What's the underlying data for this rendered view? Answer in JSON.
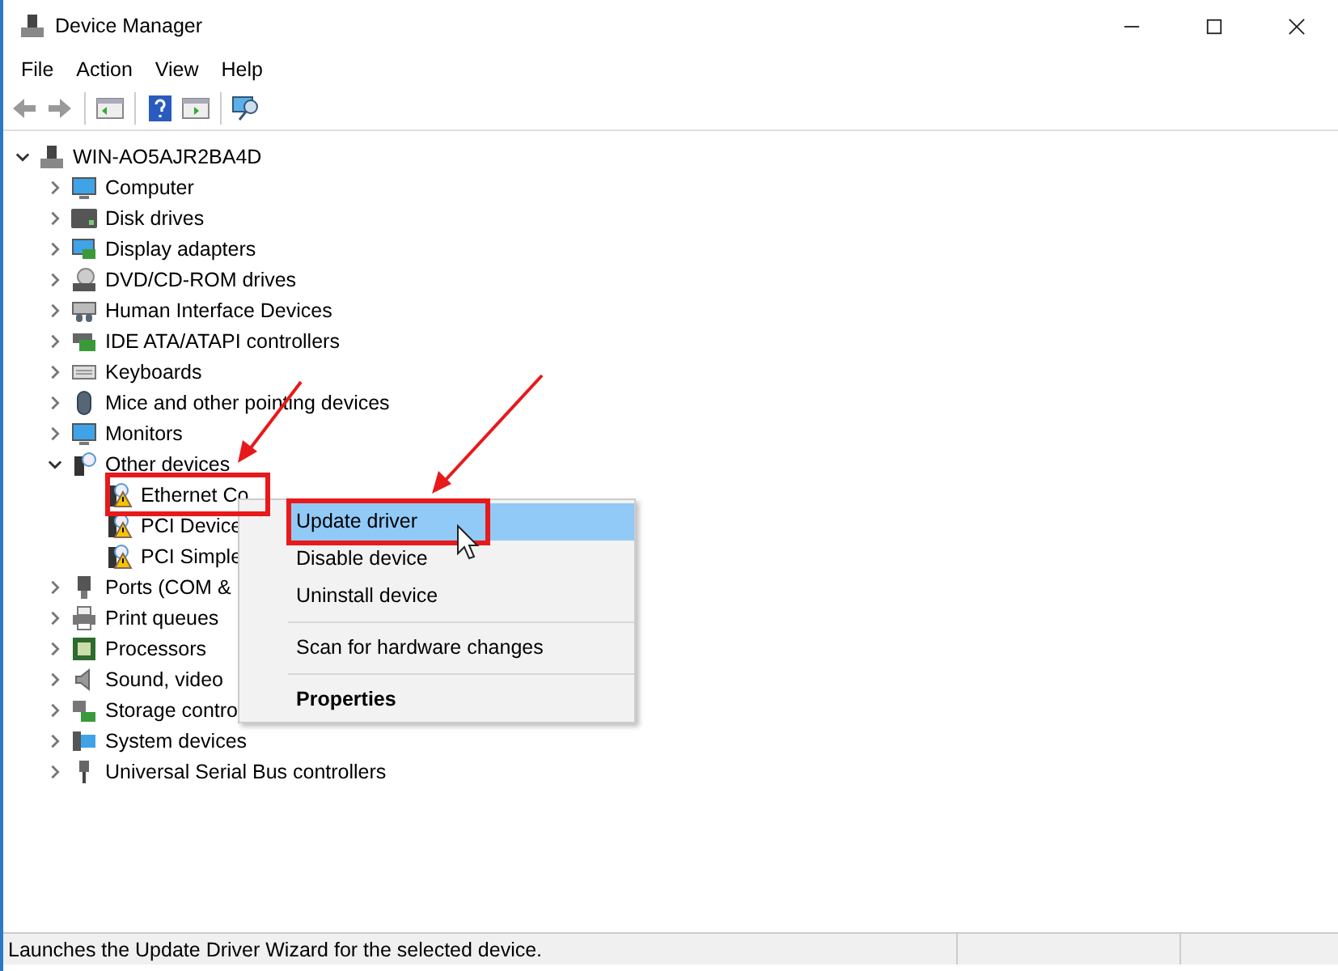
{
  "window": {
    "title": "Device Manager"
  },
  "menu_bar": [
    "File",
    "Action",
    "View",
    "Help"
  ],
  "tree": {
    "label": "WIN-AO5AJR2BA4D",
    "expanded": true,
    "children": [
      {
        "label": "Computer",
        "expanded": false
      },
      {
        "label": "Disk drives",
        "expanded": false
      },
      {
        "label": "Display adapters",
        "expanded": false
      },
      {
        "label": "DVD/CD-ROM drives",
        "expanded": false
      },
      {
        "label": "Human Interface Devices",
        "expanded": false
      },
      {
        "label": "IDE ATA/ATAPI controllers",
        "expanded": false
      },
      {
        "label": "Keyboards",
        "expanded": false
      },
      {
        "label": "Mice and other pointing devices",
        "expanded": false
      },
      {
        "label": "Monitors",
        "expanded": false
      },
      {
        "label": "Other devices",
        "expanded": true,
        "children": [
          {
            "label": "Ethernet Co",
            "warning": true
          },
          {
            "label": "PCI Device",
            "warning": true
          },
          {
            "label": "PCI Simple",
            "warning": true
          }
        ]
      },
      {
        "label": "Ports (COM &",
        "expanded": false
      },
      {
        "label": "Print queues",
        "expanded": false
      },
      {
        "label": "Processors",
        "expanded": false
      },
      {
        "label": "Sound, video",
        "expanded": false
      },
      {
        "label": "Storage contro",
        "expanded": false
      },
      {
        "label": "System devices",
        "expanded": false
      },
      {
        "label": "Universal Serial Bus controllers",
        "expanded": false
      }
    ]
  },
  "context_menu": {
    "items": [
      {
        "kind": "item",
        "label": "Update driver",
        "selected": true,
        "default": false
      },
      {
        "kind": "item",
        "label": "Disable device",
        "selected": false,
        "default": false
      },
      {
        "kind": "item",
        "label": "Uninstall device",
        "selected": false,
        "default": false
      },
      {
        "kind": "separator"
      },
      {
        "kind": "item",
        "label": "Scan for hardware changes",
        "selected": false,
        "default": false
      },
      {
        "kind": "separator"
      },
      {
        "kind": "item",
        "label": "Properties",
        "selected": false,
        "default": true
      }
    ]
  },
  "status_bar": {
    "text": "Launches the Update Driver Wizard for the selected device."
  }
}
